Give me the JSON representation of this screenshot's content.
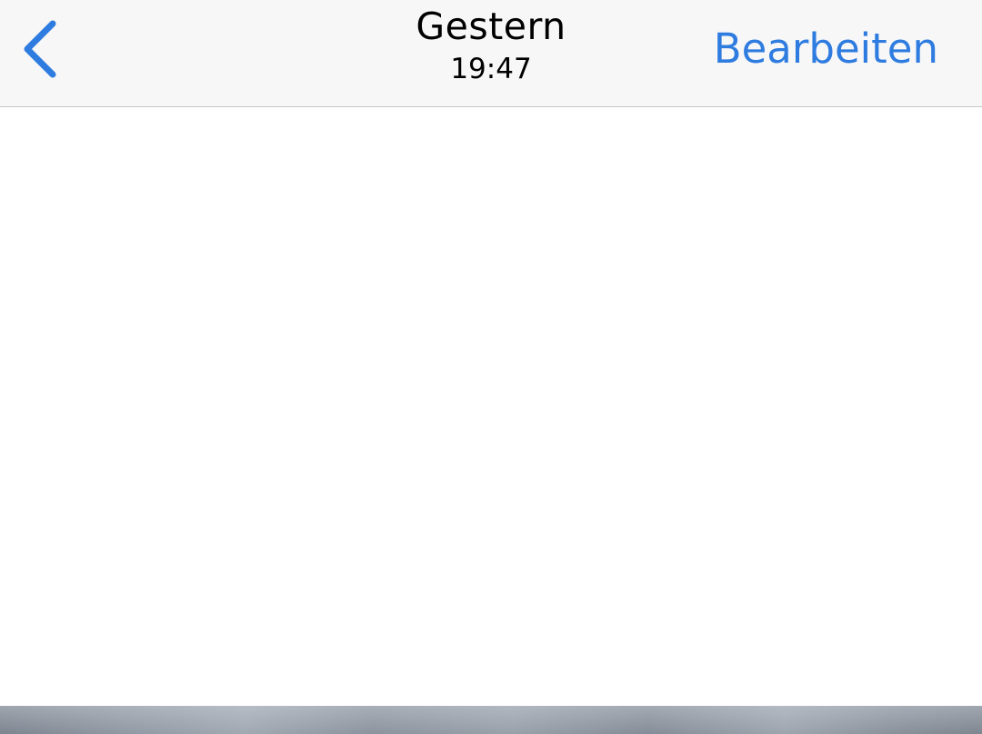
{
  "navbar": {
    "back_icon": "chevron-left-icon",
    "title": "Gestern",
    "subtitle": "19:47",
    "edit_label": "Bearbeiten"
  },
  "colors": {
    "accent": "#2f7ce0",
    "navbar_bg": "#f7f7f7",
    "separator": "#c8c8ca",
    "content_bg": "#ffffff"
  }
}
